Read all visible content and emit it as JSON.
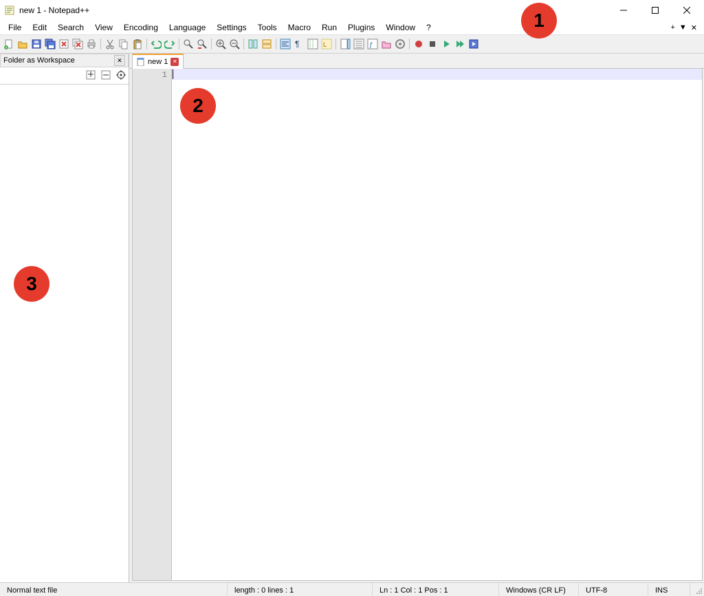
{
  "window": {
    "title": "new 1 - Notepad++"
  },
  "menu": {
    "items": [
      "File",
      "Edit",
      "Search",
      "View",
      "Encoding",
      "Language",
      "Settings",
      "Tools",
      "Macro",
      "Run",
      "Plugins",
      "Window",
      "?"
    ],
    "right": {
      "plus": "+",
      "down": "▼",
      "close": "✕"
    }
  },
  "sidebar": {
    "title": "Folder as Workspace"
  },
  "tabs": {
    "active": {
      "label": "new 1"
    }
  },
  "editor": {
    "line_number": "1"
  },
  "statusbar": {
    "filetype": "Normal text file",
    "length_lines": "length : 0    lines : 1",
    "position": "Ln : 1    Col : 1    Pos : 1",
    "eol": "Windows (CR LF)",
    "encoding": "UTF-8",
    "mode": "INS"
  },
  "annotations": {
    "a1": "1",
    "a2": "2",
    "a3": "3"
  }
}
